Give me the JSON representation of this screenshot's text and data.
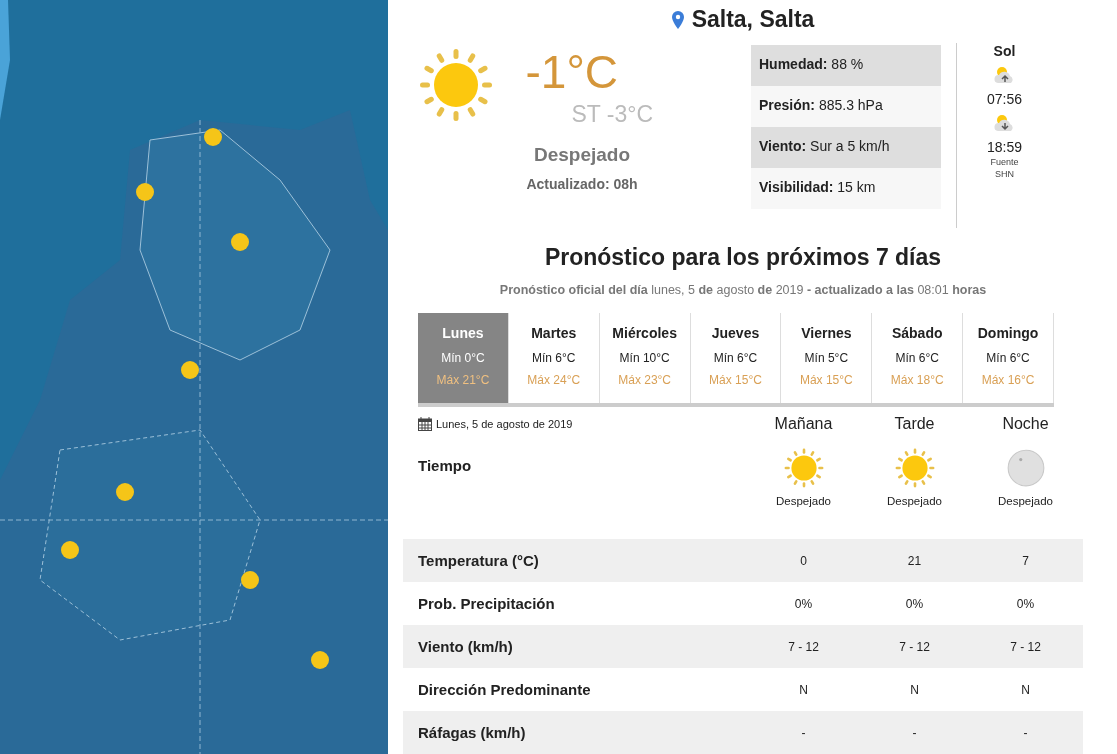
{
  "location": {
    "title": "Salta, Salta"
  },
  "current": {
    "temperature": "-1°C",
    "feels_like": "ST -3°C",
    "condition": "Despejado",
    "updated": "Actualizado: 08h"
  },
  "details": [
    {
      "label": "Humedad:",
      "value": "88 %"
    },
    {
      "label": "Presión:",
      "value": "885.3 hPa"
    },
    {
      "label": "Viento:",
      "value": "Sur a 5 km/h"
    },
    {
      "label": "Visibilidad:",
      "value": "15 km"
    }
  ],
  "sun": {
    "title": "Sol",
    "sunrise": "07:56",
    "sunset": "18:59",
    "source": "Fuente",
    "source_name": "SHN"
  },
  "forecast": {
    "title": "Pronóstico para los próximos 7 días",
    "subtitle": "**Pronóstico oficial del día** lunes, 5 **de** agosto **de** 2019 **- actualizado a las** 08:01 **horas**",
    "days": [
      {
        "name": "Lunes",
        "min": "Mín 0°C",
        "max": "Máx 21°C",
        "selected": true
      },
      {
        "name": "Martes",
        "min": "Mín 6°C",
        "max": "Máx 24°C",
        "selected": false
      },
      {
        "name": "Miércoles",
        "min": "Mín 10°C",
        "max": "Máx 23°C",
        "selected": false
      },
      {
        "name": "Jueves",
        "min": "Mín 6°C",
        "max": "Máx 15°C",
        "selected": false
      },
      {
        "name": "Viernes",
        "min": "Mín 5°C",
        "max": "Máx 15°C",
        "selected": false
      },
      {
        "name": "Sábado",
        "min": "Mín 6°C",
        "max": "Máx 18°C",
        "selected": false
      },
      {
        "name": "Domingo",
        "min": "Mín 6°C",
        "max": "Máx 16°C",
        "selected": false
      }
    ]
  },
  "detail": {
    "date": "Lunes, 5 de agosto de 2019",
    "periods": [
      "Mañana",
      "Tarde",
      "Noche"
    ],
    "weather_label": "Tiempo",
    "weather": [
      {
        "kind": "sun",
        "text": "Despejado"
      },
      {
        "kind": "sun",
        "text": "Despejado"
      },
      {
        "kind": "moon",
        "text": "Despejado"
      }
    ],
    "rows": [
      {
        "label": "Temperatura (°C)",
        "values": [
          "0",
          "21",
          "7"
        ]
      },
      {
        "label": "Prob. Precipitación",
        "values": [
          "0%",
          "0%",
          "0%"
        ]
      },
      {
        "label": "Viento (km/h)",
        "values": [
          "7 - 12",
          "7 - 12",
          "7 - 12"
        ]
      },
      {
        "label": "Dirección Predominante",
        "values": [
          "N",
          "N",
          "N"
        ]
      },
      {
        "label": "Ráfagas (km/h)",
        "values": [
          "-",
          "-",
          "-"
        ]
      }
    ]
  }
}
